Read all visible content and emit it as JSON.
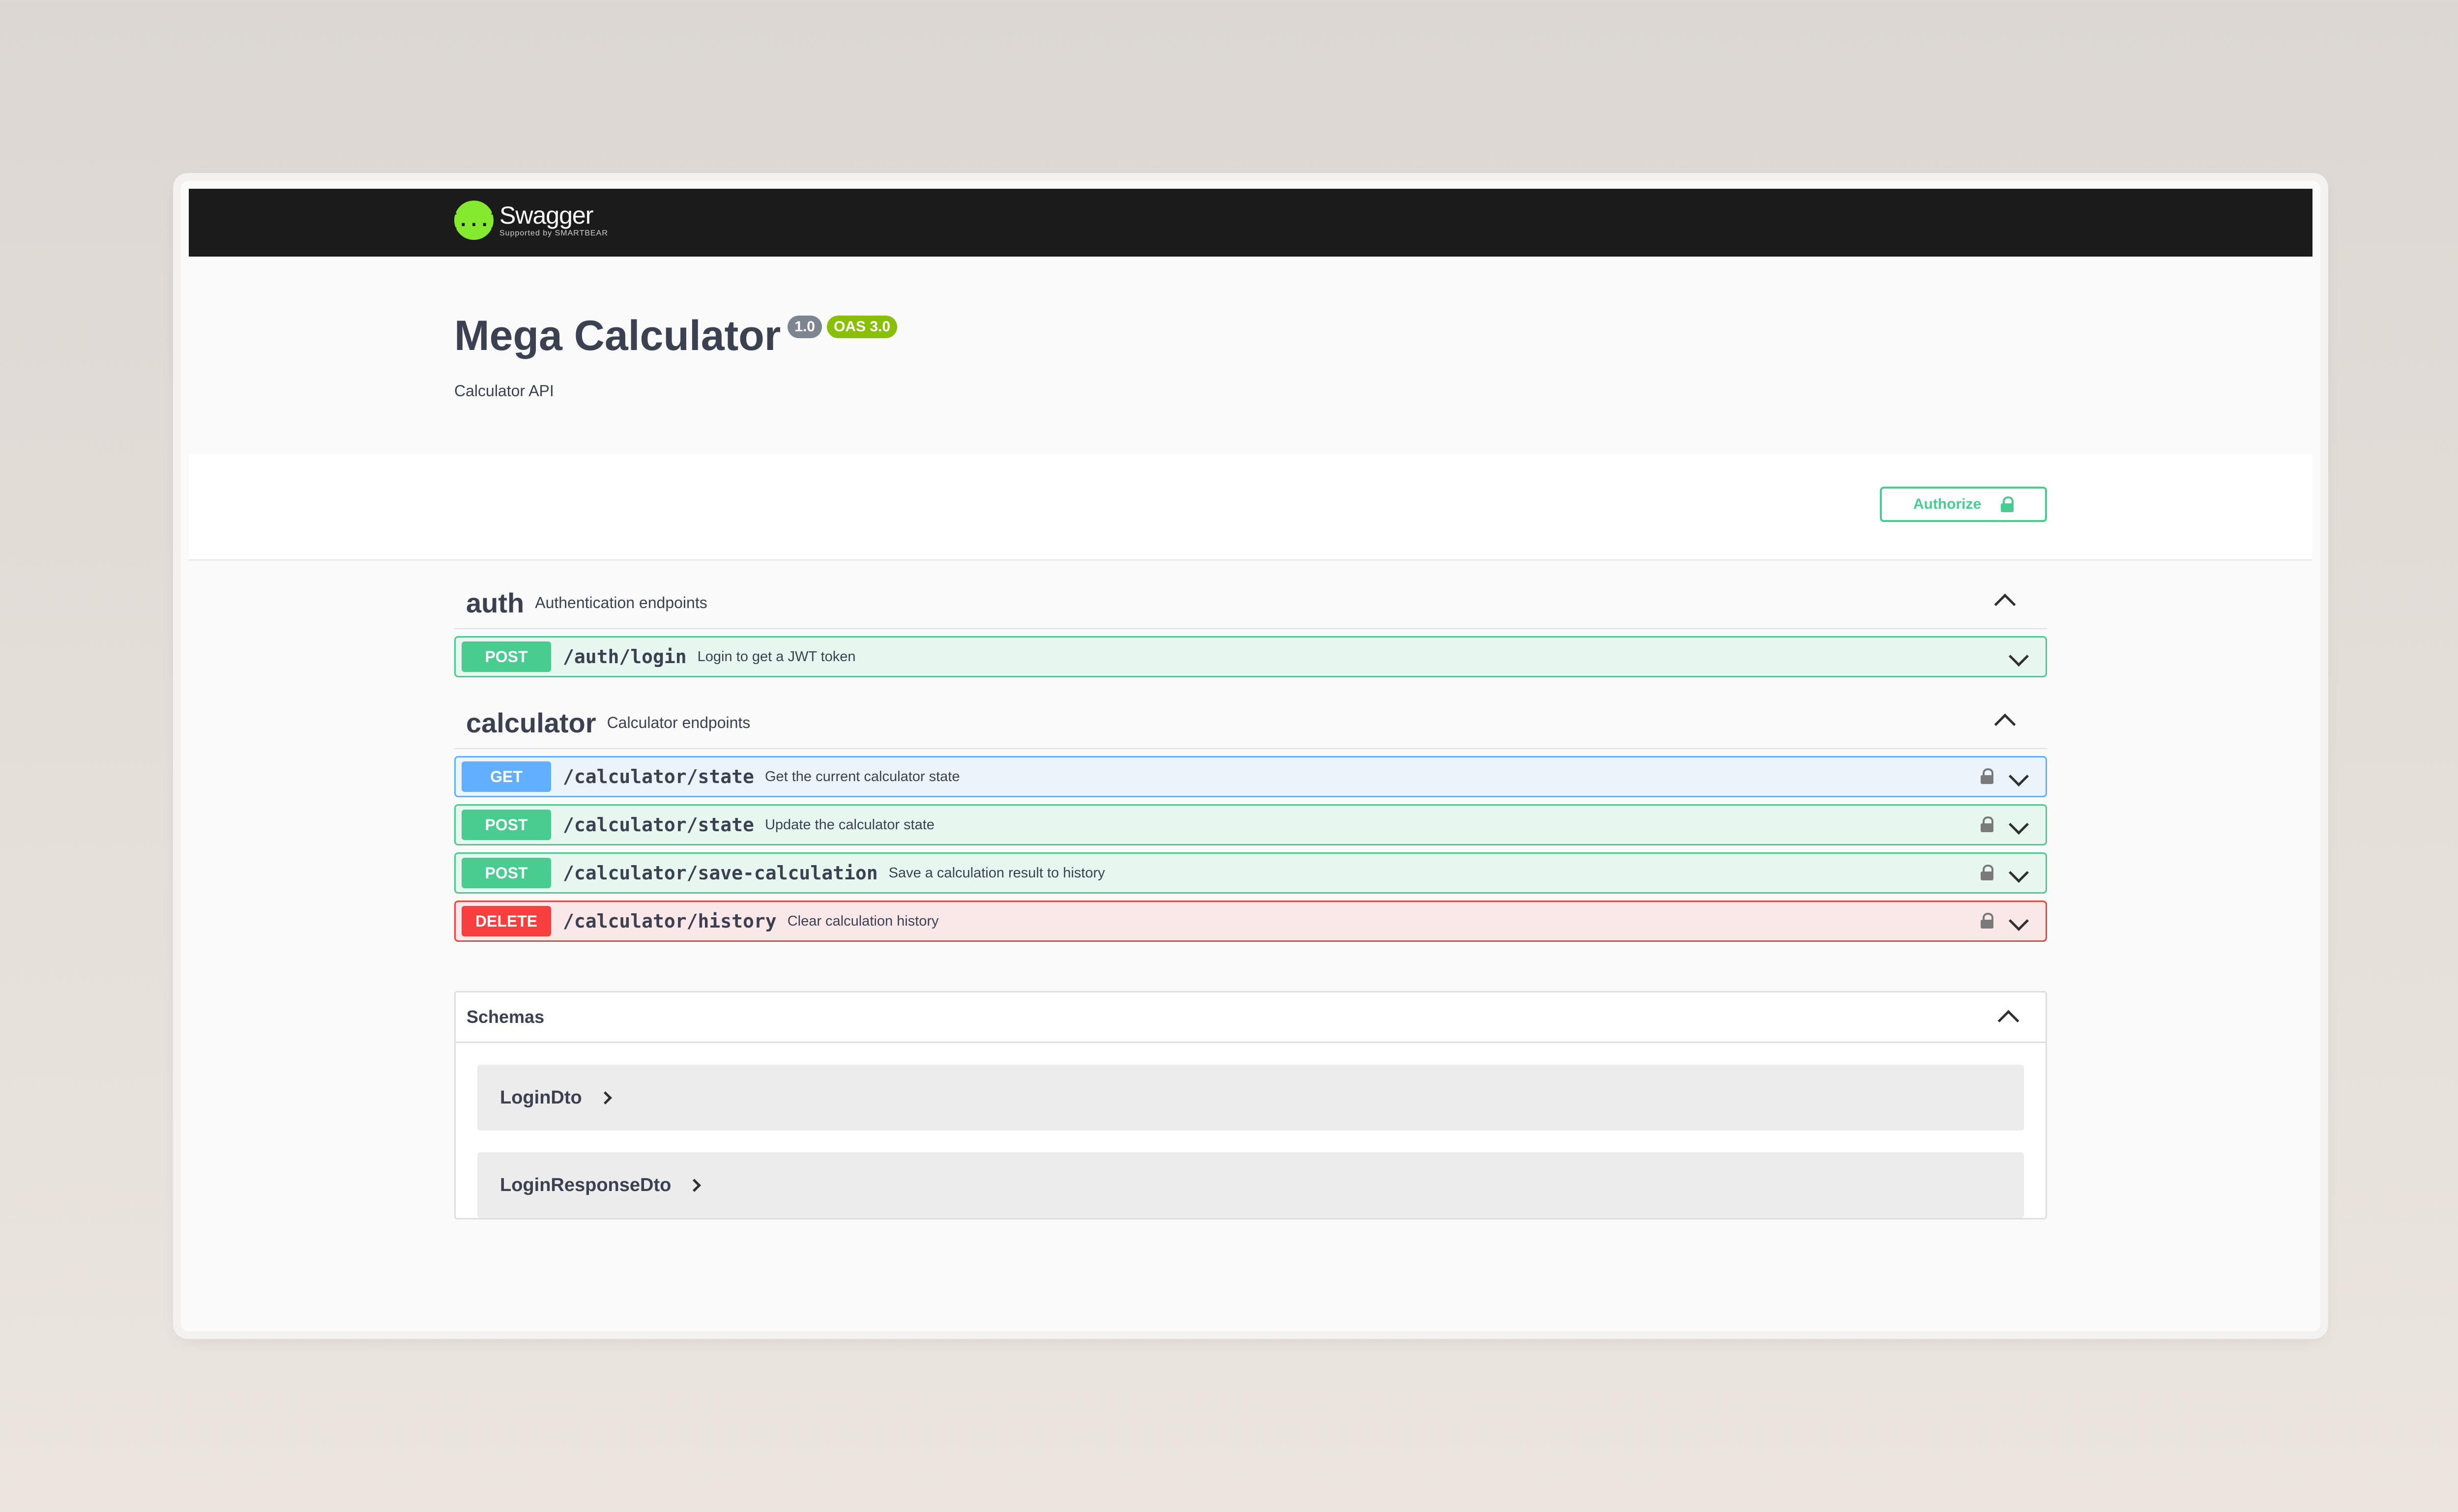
{
  "topbar": {
    "logo_glyph": "{...}",
    "logo_name": "Swagger",
    "logo_sub": "Supported by SMARTBEAR"
  },
  "info": {
    "title": "Mega Calculator",
    "version": "1.0",
    "oas": "OAS 3.0",
    "description": "Calculator API"
  },
  "authorize": {
    "label": "Authorize"
  },
  "tags": [
    {
      "name": "auth",
      "description": "Authentication endpoints",
      "operations": [
        {
          "method": "POST",
          "path": "/auth/login",
          "summary": "Login to get a JWT token"
        }
      ]
    },
    {
      "name": "calculator",
      "description": "Calculator endpoints",
      "operations": [
        {
          "method": "GET",
          "path": "/calculator/state",
          "summary": "Get the current calculator state"
        },
        {
          "method": "POST",
          "path": "/calculator/state",
          "summary": "Update the calculator state"
        },
        {
          "method": "POST",
          "path": "/calculator/save-calculation",
          "summary": "Save a calculation result to history"
        },
        {
          "method": "DELETE",
          "path": "/calculator/history",
          "summary": "Clear calculation history"
        }
      ]
    }
  ],
  "schemas": {
    "title": "Schemas",
    "models": [
      "LoginDto",
      "LoginResponseDto"
    ]
  },
  "colors": {
    "post": "#49cc90",
    "get": "#61affe",
    "delete": "#f93e3e",
    "swagger_green": "#85ea2d"
  }
}
